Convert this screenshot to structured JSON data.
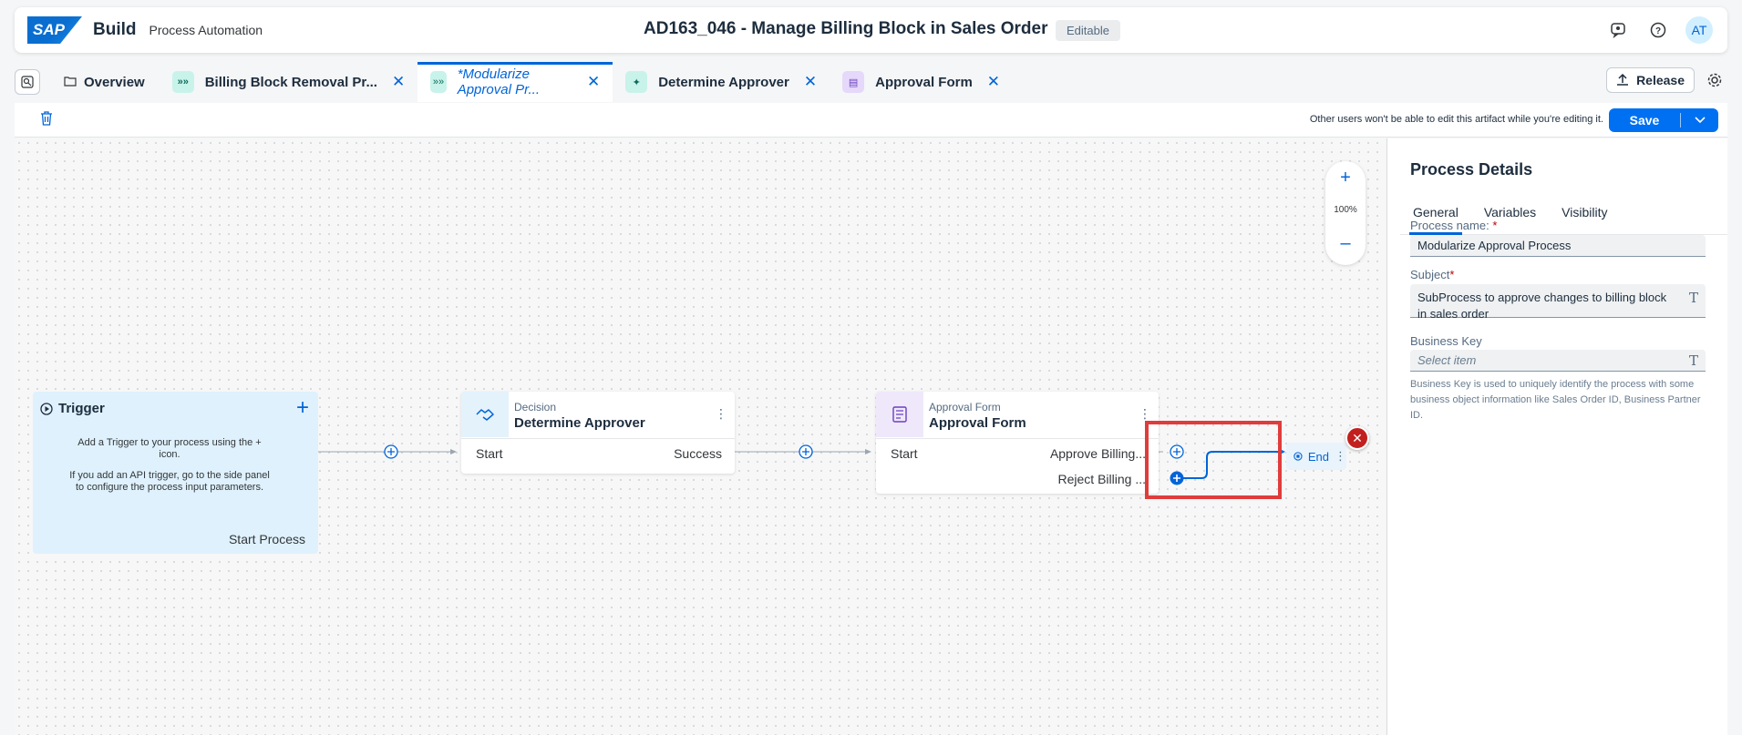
{
  "shell": {
    "logo": "SAP",
    "product": "Build",
    "subtitle": "Process Automation",
    "title": "AD163_046 - Manage Billing Block in Sales Order",
    "status": "Editable",
    "user_initials": "AT"
  },
  "tabs": {
    "overview": "Overview",
    "items": [
      {
        "label": "Billing Block Removal Pr...",
        "icon": "process-icon"
      },
      {
        "label": "*Modularize Approval Pr...",
        "icon": "process-icon",
        "active": true
      },
      {
        "label": "Determine Approver",
        "icon": "decision-icon"
      },
      {
        "label": "Approval Form",
        "icon": "form-icon"
      }
    ],
    "release": "Release"
  },
  "toolbar": {
    "lock_message": "Other users won't be able to edit this artifact while you're editing it.",
    "save": "Save"
  },
  "canvas": {
    "zoom": "100%",
    "trigger": {
      "title": "Trigger",
      "desc1": "Add a Trigger to your process using the + icon.",
      "desc2": "If you add an API trigger, go to the side panel to configure the process input parameters.",
      "output": "Start Process"
    },
    "decision": {
      "type": "Decision",
      "name": "Determine Approver",
      "input": "Start",
      "output": "Success"
    },
    "form": {
      "type": "Approval Form",
      "name": "Approval Form",
      "input": "Start",
      "output1": "Approve Billing...",
      "output2": "Reject Billing ..."
    },
    "end": "End"
  },
  "panel": {
    "title": "Process Details",
    "tabs": [
      "General",
      "Variables",
      "Visibility"
    ],
    "process_name_label": "Process name:",
    "process_name": "Modularize Approval Process",
    "subject_label": "Subject",
    "subject": "SubProcess to approve changes to billing block in sales order",
    "business_key_label": "Business Key",
    "business_key_placeholder": "Select item",
    "help": "Business Key is used to uniquely identify the process with some business object information like Sales Order ID, Business Partner ID."
  },
  "colors": {
    "accent": "#0064d9",
    "save": "#0070f2",
    "error": "#c2201f",
    "highlight": "#e03c3c"
  }
}
